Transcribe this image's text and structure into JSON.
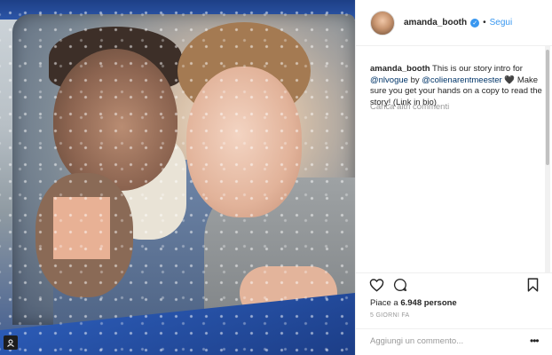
{
  "post": {
    "username": "amanda_booth",
    "separator": "•",
    "follow_label": "Segui",
    "caption_prefix": "This is our story intro for",
    "caption_tag1": "@nlvogue",
    "caption_by": "by",
    "caption_tag2": "@colienarentmeester",
    "caption_heart": "🖤",
    "caption_rest": "Make sure you get your hands on a copy to read the story! (Link in bio)",
    "load_more": "Carica altri commenti",
    "likes_prefix": "Piace a",
    "likes_count": "6.948",
    "likes_suffix": "persone",
    "timestamp": "5 GIORNI FA",
    "comment_placeholder": "Aggiungi un commento...",
    "more_glyph": "•••"
  },
  "colors": {
    "link": "#3897f0",
    "text": "#262626",
    "muted": "#999999",
    "border": "#efefef"
  },
  "icons": [
    "verified-badge-icon",
    "heart-icon",
    "comment-icon",
    "bookmark-icon",
    "more-options-icon",
    "instagram-corner-icon"
  ]
}
